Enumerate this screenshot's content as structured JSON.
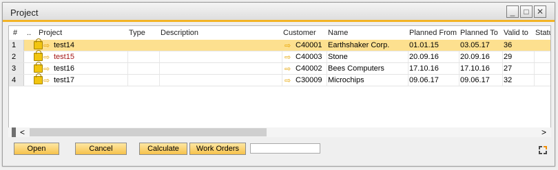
{
  "window": {
    "title": "Project"
  },
  "window_buttons": {
    "minimize": "_",
    "maximize": "□",
    "close": "✕"
  },
  "columns": [
    "#",
    "..",
    "Project",
    "Type",
    "Description",
    "Customer",
    "Name",
    "Planned From",
    "Planned To",
    "Valid to",
    "Statu"
  ],
  "rows": [
    {
      "num": "1",
      "project": "test14",
      "customer": "C40001",
      "name": "Earthshaker Corp.",
      "from": "01.01.15",
      "to": "03.05.17",
      "valid": "36"
    },
    {
      "num": "2",
      "project": "test15",
      "customer": "C40003",
      "name": "Stone",
      "from": "20.09.16",
      "to": "20.09.16",
      "valid": "29"
    },
    {
      "num": "3",
      "project": "test16",
      "customer": "C40002",
      "name": "Bees Computers",
      "from": "17.10.16",
      "to": "17.10.16",
      "valid": "27"
    },
    {
      "num": "4",
      "project": "test17",
      "customer": "C30009",
      "name": "Microchips",
      "from": "09.06.17",
      "to": "09.06.17",
      "valid": "32"
    }
  ],
  "scroll": {
    "left": "<",
    "right": ">"
  },
  "buttons": {
    "open": "Open",
    "cancel": "Cancel",
    "calculate": "Calculate",
    "work_orders": "Work Orders"
  },
  "search": {
    "value": ""
  },
  "colors": {
    "accent": "#f3b324",
    "selected_row": "#fde08f",
    "red_text": "#a31515"
  }
}
